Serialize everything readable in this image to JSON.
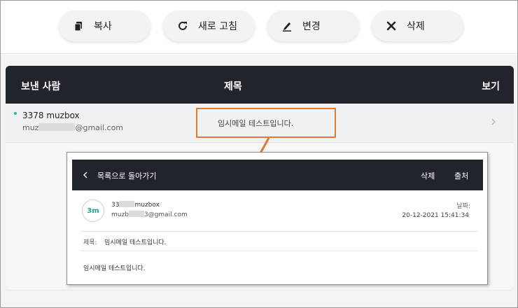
{
  "toolbar": {
    "copy_label": "복사",
    "refresh_label": "새로 고침",
    "change_label": "변경",
    "delete_label": "삭제"
  },
  "table": {
    "headers": {
      "sender": "보낸 사람",
      "subject": "제목",
      "view": "보기"
    },
    "rows": [
      {
        "sender_name": "3378 muzbox",
        "sender_email_prefix": "muz",
        "sender_email_suffix": "@gmail.com",
        "subject": "임시메일 테스트입니다."
      }
    ]
  },
  "detail": {
    "back_label": "목록으로 돌아가기",
    "delete_label": "삭제",
    "source_label": "출처",
    "avatar_text": "3m",
    "sender_name_prefix": "33",
    "sender_name_suffix": "muzbox",
    "sender_email_prefix": "muzb",
    "sender_email_suffix": "3@gmail.com",
    "date_label": "날짜:",
    "date": "20-12-2021 15:41:34",
    "subject_label": "제목:",
    "subject": "임시메일 테스트입니다.",
    "body": "임시메일 테스트입니다."
  },
  "colors": {
    "header_bg": "#22242b",
    "accent": "#2db5a3",
    "highlight": "#e07a35"
  },
  "icons": {
    "copy": "copy-icon",
    "refresh": "refresh-icon",
    "change": "pen-icon",
    "delete": "x-icon",
    "chevron": "chevron-right-icon",
    "back": "chevron-left-icon"
  }
}
